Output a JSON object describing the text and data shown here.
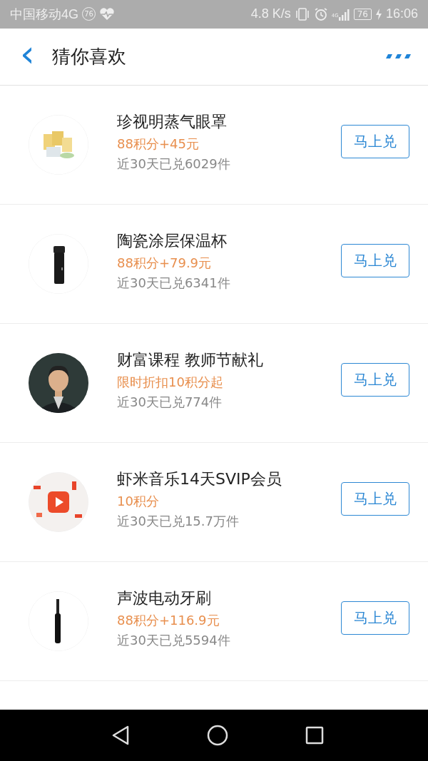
{
  "status_bar": {
    "carrier": "中国移动4G",
    "badge": "76",
    "speed": "4.8 K/s",
    "network": "4G",
    "battery": "76",
    "time": "16:06"
  },
  "header": {
    "back": "‹",
    "title": "猜你喜欢"
  },
  "items": [
    {
      "title": "珍视明蒸气眼罩",
      "price": "88积分+45元",
      "sold": "近30天已兑6029件",
      "button": "马上兑"
    },
    {
      "title": "陶瓷涂层保温杯",
      "price": "88积分+79.9元",
      "sold": "近30天已兑6341件",
      "button": "马上兑"
    },
    {
      "title": "财富课程 教师节献礼",
      "price": "限时折扣10积分起",
      "sold": "近30天已兑774件",
      "button": "马上兑"
    },
    {
      "title": "虾米音乐14天SVIP会员",
      "price": "10积分",
      "sold": "近30天已兑15.7万件",
      "button": "马上兑"
    },
    {
      "title": "声波电动牙刷",
      "price": "88积分+116.9元",
      "sold": "近30天已兑5594件",
      "button": "马上兑"
    }
  ]
}
